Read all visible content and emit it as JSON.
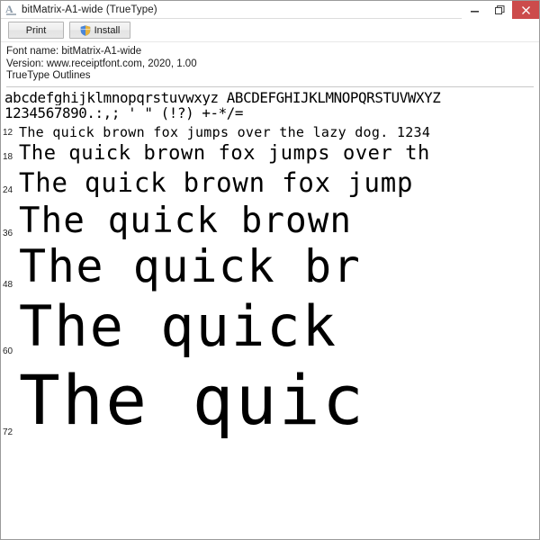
{
  "window": {
    "title": "bitMatrix-A1-wide (TrueType)",
    "icon": "font-file-icon",
    "controls": {
      "minimize": "minimize-icon",
      "restore": "restore-icon",
      "close": "close-icon"
    },
    "close_button_color": "#cc4b4b"
  },
  "toolbar": {
    "print_label": "Print",
    "install_label": "Install",
    "install_icon": "uac-shield-icon"
  },
  "info": {
    "font_name_line": "Font name: bitMatrix-A1-wide",
    "version_line": "Version: www.receiptfont.com, 2020, 1.00",
    "outlines_line": "TrueType Outlines"
  },
  "charset": {
    "line1": "abcdefghijklmnopqrstuvwxyz ABCDEFGHIJKLMNOPQRSTUVWXYZ",
    "line2": "1234567890.:,; ' \" (!?) +-*/="
  },
  "samples": [
    {
      "size": "12",
      "text": "The quick brown fox jumps over the lazy dog. 1234"
    },
    {
      "size": "18",
      "text": "The quick brown fox jumps over th"
    },
    {
      "size": "24",
      "text": "The quick brown fox jump"
    },
    {
      "size": "36",
      "text": "The quick brown"
    },
    {
      "size": "48",
      "text": "The quick br"
    },
    {
      "size": "60",
      "text": "The quick"
    },
    {
      "size": "72",
      "text": "The quic"
    }
  ]
}
